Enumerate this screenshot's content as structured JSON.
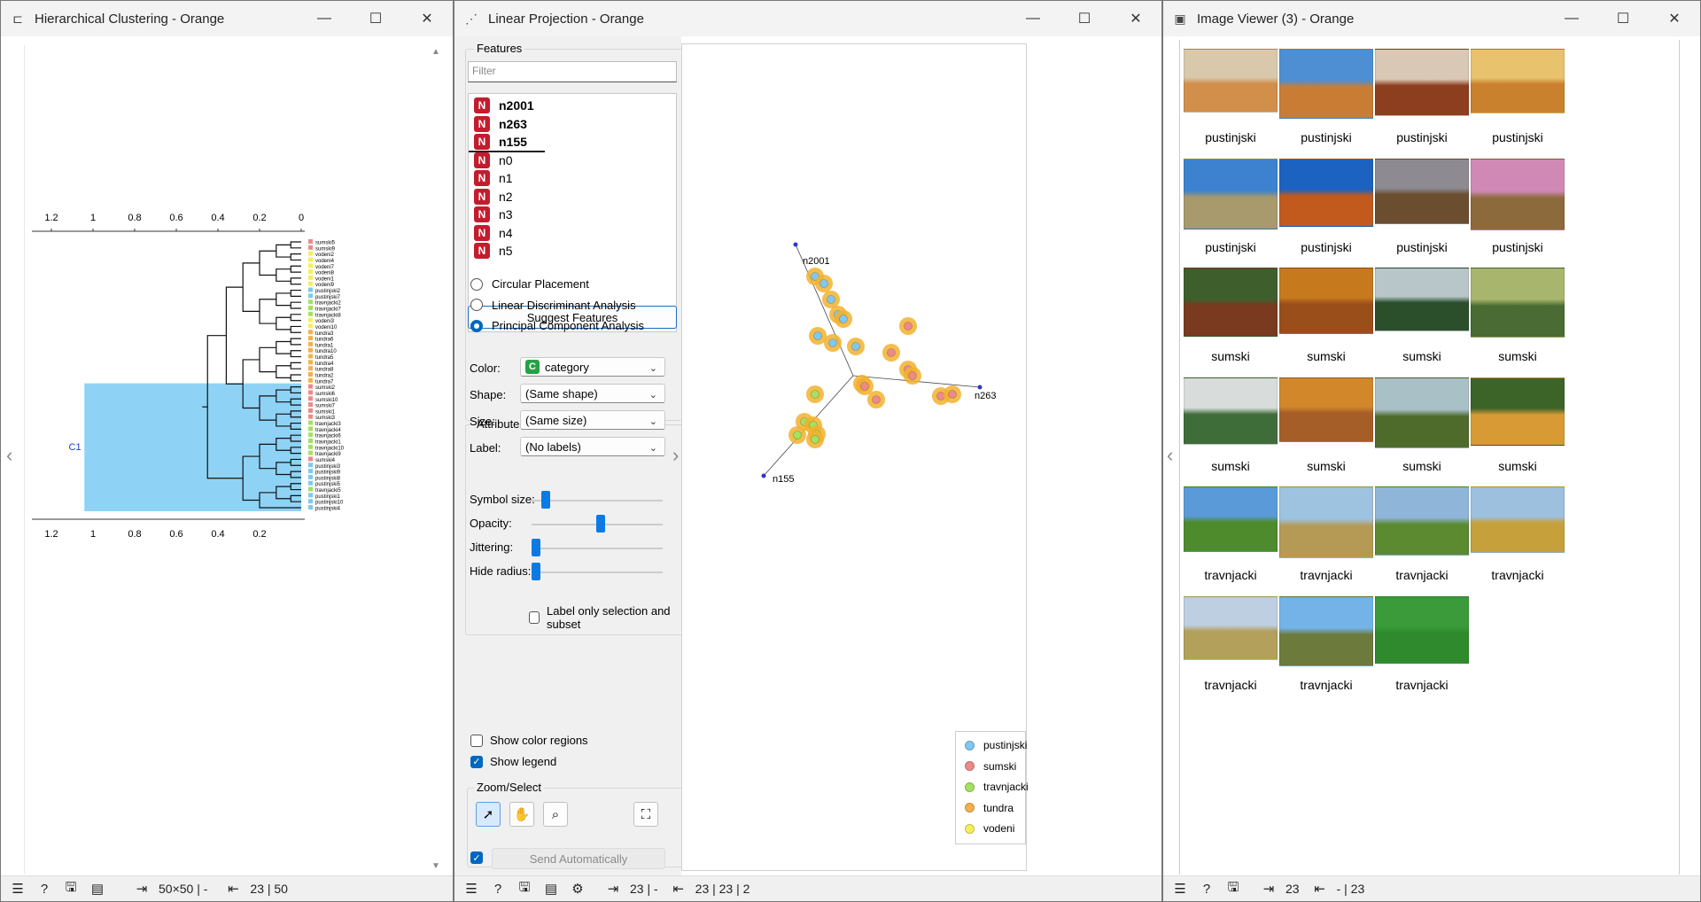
{
  "hc": {
    "title": "Hierarchical Clustering - Orange",
    "axis_ticks_top": [
      "1.2",
      "1",
      "0.8",
      "0.6",
      "0.4",
      "0.2",
      "0"
    ],
    "axis_ticks_bottom": [
      "1.2",
      "1",
      "0.8",
      "0.6",
      "0.4",
      "0.2"
    ],
    "cluster_label": "C1",
    "leaves": [
      "sumski5",
      "sumski9",
      "vodeni2",
      "vodeni4",
      "vodeni7",
      "vodeni8",
      "vodeni1",
      "vodeni9",
      "pustinjski2",
      "pustinjski7",
      "travnjacki2",
      "travnjacki7",
      "travnjacki8",
      "vodeni3",
      "vodeni10",
      "tundra3",
      "tundra6",
      "tundra1",
      "tundra10",
      "tundra5",
      "tundra4",
      "tundra8",
      "tundra2",
      "tundra7",
      "sumski2",
      "sumski6",
      "sumski10",
      "sumski7",
      "sumski1",
      "sumski3",
      "travnjacki3",
      "travnjacki4",
      "travnjacki6",
      "travnjacki1",
      "travnjacki10",
      "travnjacki9",
      "sumski4",
      "pustinjski3",
      "pustinjski9",
      "pustinjski8",
      "pustinjski5",
      "travnjacki5",
      "pustinjski1",
      "pustinjski10",
      "pustinjski4"
    ],
    "status_in": "50×50 | -",
    "status_out": "23 | 50"
  },
  "lp": {
    "title": "Linear Projection - Orange",
    "features_title": "Features",
    "filter_placeholder": "Filter",
    "features": [
      {
        "badge": "N",
        "name": "n2001",
        "bold": true
      },
      {
        "badge": "N",
        "name": "n263",
        "bold": true
      },
      {
        "badge": "N",
        "name": "n155",
        "bold": true
      },
      {
        "badge": "N",
        "name": "n0",
        "bold": false
      },
      {
        "badge": "N",
        "name": "n1",
        "bold": false
      },
      {
        "badge": "N",
        "name": "n2",
        "bold": false
      },
      {
        "badge": "N",
        "name": "n3",
        "bold": false
      },
      {
        "badge": "N",
        "name": "n4",
        "bold": false
      },
      {
        "badge": "N",
        "name": "n5",
        "bold": false
      }
    ],
    "suggest_button": "Suggest Features",
    "placements": [
      {
        "label": "Circular Placement",
        "selected": false
      },
      {
        "label": "Linear Discriminant Analysis",
        "selected": false
      },
      {
        "label": "Principal Component Analysis",
        "selected": true
      }
    ],
    "attributes_title": "Attributes",
    "attr_rows": [
      {
        "label": "Color:",
        "value": "category",
        "badge": "C"
      },
      {
        "label": "Shape:",
        "value": "(Same shape)"
      },
      {
        "label": "Size:",
        "value": "(Same size)"
      },
      {
        "label": "Label:",
        "value": "(No labels)"
      }
    ],
    "label_only_selection": "Label only selection and subset",
    "sliders": [
      {
        "label": "Symbol size:",
        "value": 0.08
      },
      {
        "label": "Opacity:",
        "value": 0.53
      },
      {
        "label": "Jittering:",
        "value": 0.0
      },
      {
        "label": "Hide radius:",
        "value": 0.0
      }
    ],
    "show_color_regions": "Show color regions",
    "show_legend": "Show legend",
    "zoom_select_title": "Zoom/Select",
    "send_auto": "Send Automatically",
    "status_in": "23 | -",
    "status_out": "23 | 23 | 2",
    "anchors": [
      {
        "label": "n2001"
      },
      {
        "label": "n263"
      },
      {
        "label": "n155"
      }
    ],
    "legend": [
      {
        "label": "pustinjski",
        "color": "#7fc8ee"
      },
      {
        "label": "sumski",
        "color": "#ec8a8a"
      },
      {
        "label": "travnjacki",
        "color": "#a4e061"
      },
      {
        "label": "tundra",
        "color": "#f4b04a"
      },
      {
        "label": "vodeni",
        "color": "#f5ef5b"
      }
    ]
  },
  "iv": {
    "title": "Image Viewer (3) - Orange",
    "images": [
      {
        "label": "pustinjski",
        "sky": "#d8c9ad",
        "ground": "#d28e4b"
      },
      {
        "label": "pustinjski",
        "sky": "#4d8fd2",
        "ground": "#c97d34"
      },
      {
        "label": "pustinjski",
        "sky": "#d9c8b5",
        "ground": "#8d3e1f"
      },
      {
        "label": "pustinjski",
        "sky": "#e8c26c",
        "ground": "#c9812e"
      },
      {
        "label": "pustinjski",
        "sky": "#3c82cf",
        "ground": "#a89a6c"
      },
      {
        "label": "pustinjski",
        "sky": "#1c62c1",
        "ground": "#c25a1e"
      },
      {
        "label": "pustinjski",
        "sky": "#8d8a92",
        "ground": "#6b4d2f"
      },
      {
        "label": "pustinjski",
        "sky": "#d089b5",
        "ground": "#8c6a3b"
      },
      {
        "label": "sumski",
        "sky": "#3e5f2c",
        "ground": "#7a3a20"
      },
      {
        "label": "sumski",
        "sky": "#c77a1d",
        "ground": "#9a4f1a"
      },
      {
        "label": "sumski",
        "sky": "#b9c6c9",
        "ground": "#2b4f2b"
      },
      {
        "label": "sumski",
        "sky": "#a8b56c",
        "ground": "#4a6b33"
      },
      {
        "label": "sumski",
        "sky": "#d8dcda",
        "ground": "#3f6d3a"
      },
      {
        "label": "sumski",
        "sky": "#d2872a",
        "ground": "#a65e28"
      },
      {
        "label": "sumski",
        "sky": "#a9c0c7",
        "ground": "#4f6b2c"
      },
      {
        "label": "sumski",
        "sky": "#3d6428",
        "ground": "#d79a35"
      },
      {
        "label": "travnjacki",
        "sky": "#5a9ad8",
        "ground": "#4d8b2c"
      },
      {
        "label": "travnjacki",
        "sky": "#9ec3e0",
        "ground": "#b59a55"
      },
      {
        "label": "travnjacki",
        "sky": "#8fb6d8",
        "ground": "#5b8a30"
      },
      {
        "label": "travnjacki",
        "sky": "#9cc0de",
        "ground": "#c6a13b"
      },
      {
        "label": "travnjacki",
        "sky": "#bdcfe0",
        "ground": "#b3a05a"
      },
      {
        "label": "travnjacki",
        "sky": "#74b3e8",
        "ground": "#6c7a3b"
      },
      {
        "label": "travnjacki",
        "sky": "#3b9a3a",
        "ground": "#2e8a2c"
      }
    ],
    "status_in": "23",
    "status_out": "- | 23"
  }
}
